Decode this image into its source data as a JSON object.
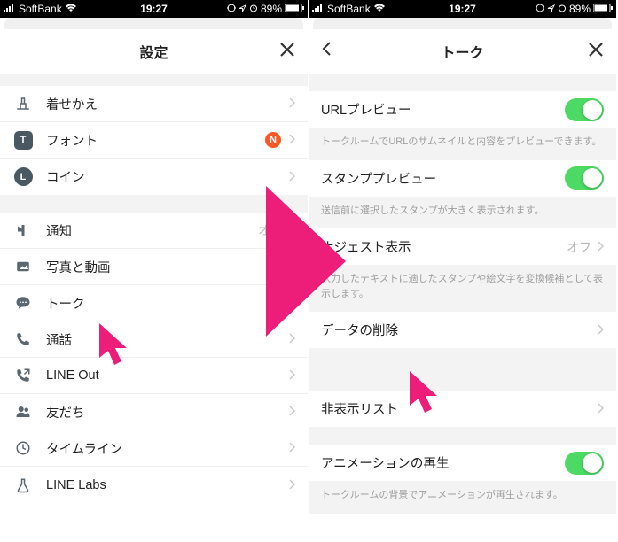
{
  "statusBar": {
    "carrier": "SoftBank",
    "time": "19:27",
    "battery": "89%"
  },
  "left": {
    "title": "設定",
    "items": [
      {
        "icon": "brush",
        "label": "着せかえ"
      },
      {
        "icon": "font",
        "label": "フォント",
        "badge": "N"
      },
      {
        "icon": "coin",
        "label": "コイン"
      }
    ],
    "items2": [
      {
        "icon": "bell",
        "label": "通知",
        "value": "オン"
      },
      {
        "icon": "photo",
        "label": "写真と動画"
      },
      {
        "icon": "chat",
        "label": "トーク"
      },
      {
        "icon": "phone",
        "label": "通話"
      },
      {
        "icon": "lineout",
        "label": "LINE Out"
      },
      {
        "icon": "friends",
        "label": "友だち"
      },
      {
        "icon": "timeline",
        "label": "タイムライン"
      },
      {
        "icon": "labs",
        "label": "LINE Labs"
      }
    ]
  },
  "right": {
    "title": "トーク",
    "rows": {
      "urlPreview": {
        "label": "URLプレビュー",
        "desc": "トークルームでURLのサムネイルと内容をプレビューできます。"
      },
      "stampPreview": {
        "label": "スタンププレビュー",
        "desc": "送信前に選択したスタンプが大きく表示されます。"
      },
      "suggest": {
        "label": "ナジェスト表示",
        "value": "オフ",
        "desc": "入力したテキストに適したスタンプや絵文字を変換候補として表示します。"
      },
      "deleteData": {
        "label": "データの削除"
      },
      "hiddenList": {
        "label": "非表示リスト"
      },
      "animation": {
        "label": "アニメーションの再生",
        "desc": "トークルームの背景でアニメーションが再生されます。"
      }
    }
  }
}
